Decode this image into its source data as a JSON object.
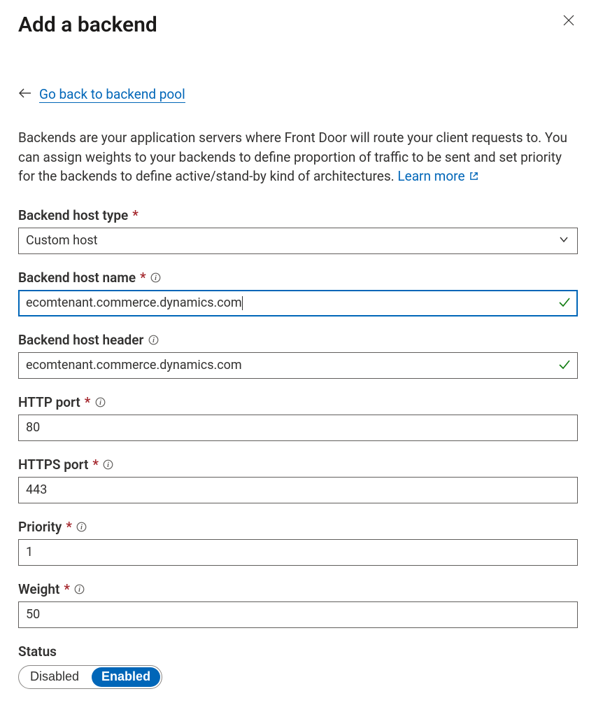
{
  "header": {
    "title": "Add a backend"
  },
  "backlink": {
    "label": "Go back to backend pool"
  },
  "description": {
    "text": "Backends are your application servers where Front Door will route your client requests to. You can assign weights to your backends to define proportion of traffic to be sent and set priority for the backends to define active/stand-by kind of architectures. ",
    "learn_more": "Learn more"
  },
  "fields": {
    "host_type": {
      "label": "Backend host type",
      "value": "Custom host"
    },
    "host_name": {
      "label": "Backend host name",
      "value": "ecomtenant.commerce.dynamics.com"
    },
    "host_header": {
      "label": "Backend host header",
      "value": "ecomtenant.commerce.dynamics.com"
    },
    "http_port": {
      "label": "HTTP port",
      "value": "80"
    },
    "https_port": {
      "label": "HTTPS port",
      "value": "443"
    },
    "priority": {
      "label": "Priority",
      "value": "1"
    },
    "weight": {
      "label": "Weight",
      "value": "50"
    },
    "status": {
      "label": "Status",
      "disabled": "Disabled",
      "enabled": "Enabled"
    }
  }
}
